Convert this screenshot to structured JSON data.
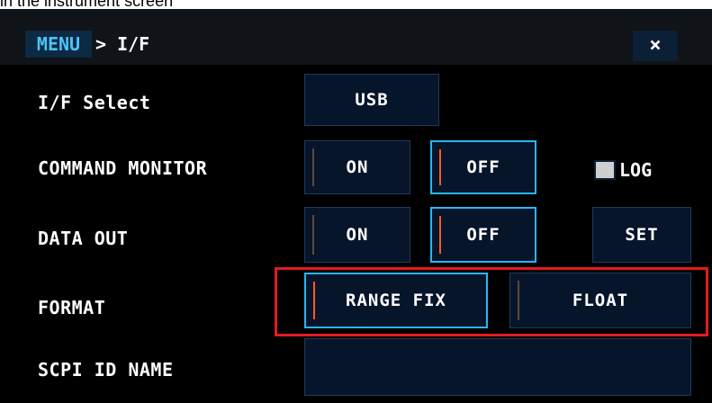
{
  "caption": "in the instrument screen",
  "titlebar": {
    "menu_label": "MENU",
    "breadcrumb": "> I/F",
    "close_label": "×"
  },
  "rows": {
    "if_select": {
      "label": "I/F Select",
      "value": "USB"
    },
    "command_monitor": {
      "label": "COMMAND MONITOR",
      "on": "ON",
      "off": "OFF",
      "selected": "OFF",
      "log_label": "LOG",
      "log_checked": false
    },
    "data_out": {
      "label": "DATA OUT",
      "on": "ON",
      "off": "OFF",
      "selected": "OFF",
      "set_label": "SET"
    },
    "format": {
      "label": "FORMAT",
      "range_fix": "RANGE FIX",
      "float": "FLOAT",
      "selected": "RANGE FIX"
    },
    "scpi_id_name": {
      "label": "SCPI ID NAME",
      "value": ""
    }
  },
  "colors": {
    "screen_bg": "#000000",
    "button_bg": "#07152b",
    "selected_border": "#29b6f6",
    "accent_mark": "#ff5a1f",
    "annotation_red": "#e31b23",
    "menu_text": "#4fc3f7"
  }
}
